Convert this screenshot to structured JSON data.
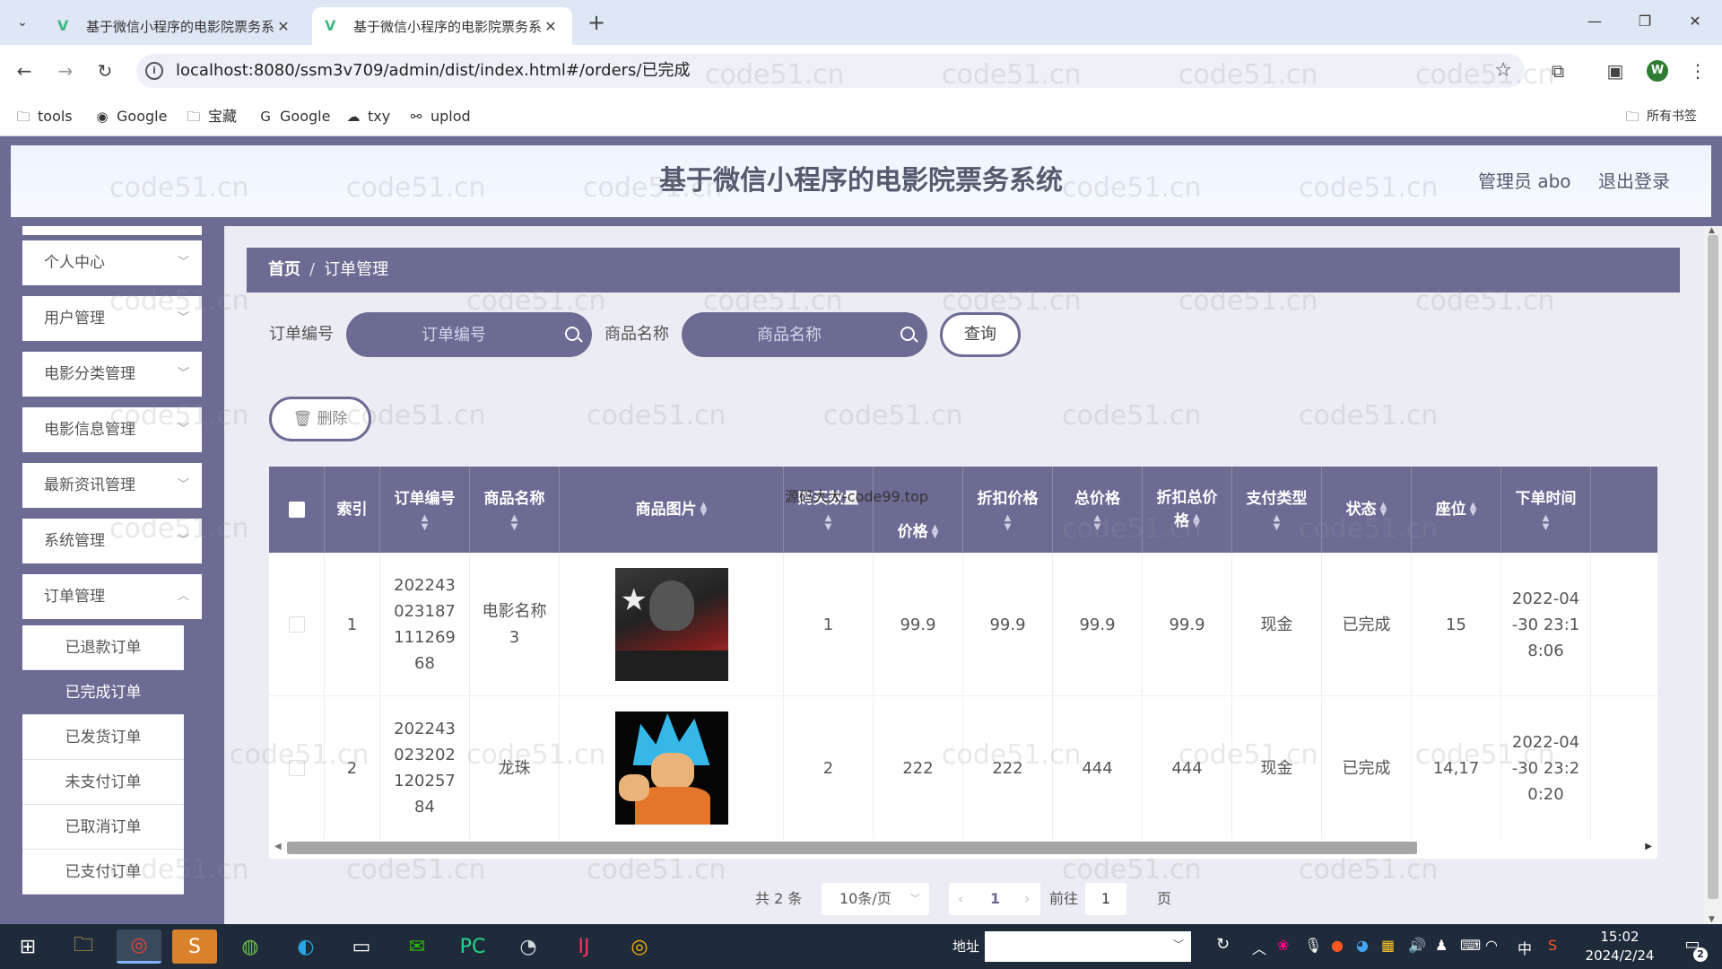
{
  "browser": {
    "tabs": [
      {
        "title": "基于微信小程序的电影院票务系统",
        "active": false
      },
      {
        "title": "基于微信小程序的电影院票务系统",
        "active": true
      }
    ],
    "url": "localhost:8080/ssm3v709/admin/dist/index.html#/orders/已完成",
    "profile_initial": "W",
    "bookmarks": [
      "tools",
      "Google",
      "宝藏",
      "Google",
      "txy",
      "uplod"
    ],
    "all_bookmarks": "所有书签"
  },
  "header": {
    "title": "基于微信小程序的电影院票务系统",
    "user": "管理员 abo",
    "logout": "退出登录"
  },
  "sidebar": {
    "items": [
      "个人中心",
      "用户管理",
      "电影分类管理",
      "电影信息管理",
      "最新资讯管理",
      "系统管理",
      "订单管理"
    ],
    "submenu": [
      "已退款订单",
      "已完成订单",
      "已发货订单",
      "未支付订单",
      "已取消订单",
      "已支付订单"
    ],
    "active_sub": "已完成订单"
  },
  "breadcrumb": {
    "home": "首页",
    "separator": "/",
    "current": "订单管理"
  },
  "filters": {
    "order_no_label": "订单编号",
    "order_no_placeholder": "订单编号",
    "goods_name_label": "商品名称",
    "goods_name_placeholder": "商品名称",
    "query": "查询"
  },
  "delete_button": "删除",
  "table": {
    "headers": {
      "index": "索引",
      "order_no": "订单编号",
      "goods_name": "商品名称",
      "goods_image": "商品图片",
      "quantity": "购买数量",
      "price": "价格",
      "discount_price": "折扣价格",
      "total_price": "总价格",
      "discount_total_line1": "折扣总价",
      "discount_total_line2": "格",
      "pay_type": "支付类型",
      "status": "状态",
      "seat": "座位",
      "order_time": "下单时间"
    },
    "rows": [
      {
        "index": "1",
        "order_no": "20224302318711126968",
        "goods_name": "电影名称3",
        "quantity": "1",
        "price": "99.9",
        "discount_price": "99.9",
        "total_price": "99.9",
        "discount_total": "99.9",
        "pay_type": "现金",
        "status": "已完成",
        "seat": "15",
        "order_time": "2022-04-30 23:18:06"
      },
      {
        "index": "2",
        "order_no": "20224302320212025784",
        "goods_name": "龙珠",
        "quantity": "2",
        "price": "222",
        "discount_price": "222",
        "total_price": "444",
        "discount_total": "444",
        "pay_type": "现金",
        "status": "已完成",
        "seat": "14,17",
        "order_time": "2022-04-30 23:20:20"
      }
    ]
  },
  "overlay_text": "源码大大-code99.top",
  "pagination": {
    "total": "共 2 条",
    "page_size": "10条/页",
    "current_page": "1",
    "goto_prefix": "前往",
    "goto_value": "1",
    "goto_suffix": "页"
  },
  "watermark": "code51.cn",
  "taskbar": {
    "address_label": "地址",
    "time": "15:02",
    "date": "2024/2/24",
    "ime": "中",
    "notifications": "2"
  }
}
